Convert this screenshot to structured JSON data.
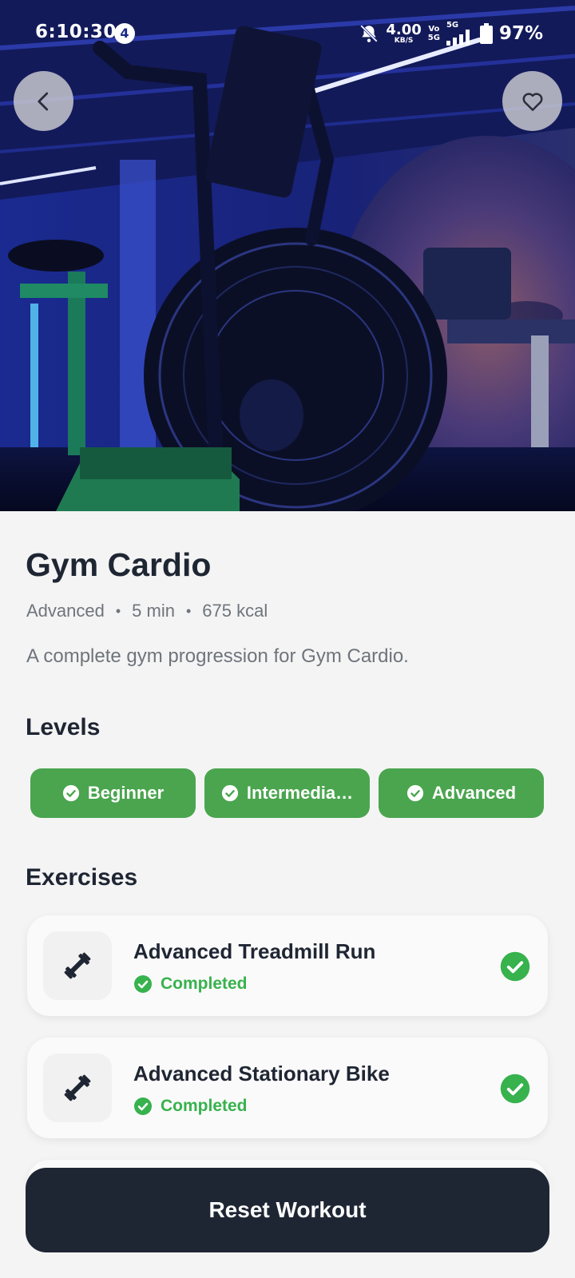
{
  "status_bar": {
    "time": "6:10:30",
    "notification_count": "4",
    "net_speed_value": "4.00",
    "net_speed_unit": "KB/S",
    "volte": "Vo\n5G",
    "network": "5G",
    "battery": "97%"
  },
  "hero": {
    "image_description_icon": "gym-airbike-photo",
    "back_icon": "chevron-left-icon",
    "favorite_icon": "heart-outline-icon"
  },
  "workout": {
    "title": "Gym Cardio",
    "level": "Advanced",
    "separator": "•",
    "duration": "5 min",
    "calories": "675 kcal",
    "description": "A complete gym progression for Gym Cardio."
  },
  "levels": {
    "heading": "Levels",
    "items": [
      {
        "label": "Beginner",
        "completed": true
      },
      {
        "label": "Intermedia…",
        "completed": true
      },
      {
        "label": "Advanced",
        "completed": true
      }
    ]
  },
  "exercises": {
    "heading": "Exercises",
    "items": [
      {
        "name": "Advanced Treadmill Run",
        "status": "Completed",
        "icon": "dumbbell-icon"
      },
      {
        "name": "Advanced Stationary Bike",
        "status": "Completed",
        "icon": "dumbbell-icon"
      }
    ]
  },
  "actions": {
    "reset_label": "Reset Workout"
  },
  "colors": {
    "accent_green": "#4aa54e",
    "status_green": "#37b24d",
    "dark": "#1f2633",
    "muted_text": "#6f747c"
  }
}
